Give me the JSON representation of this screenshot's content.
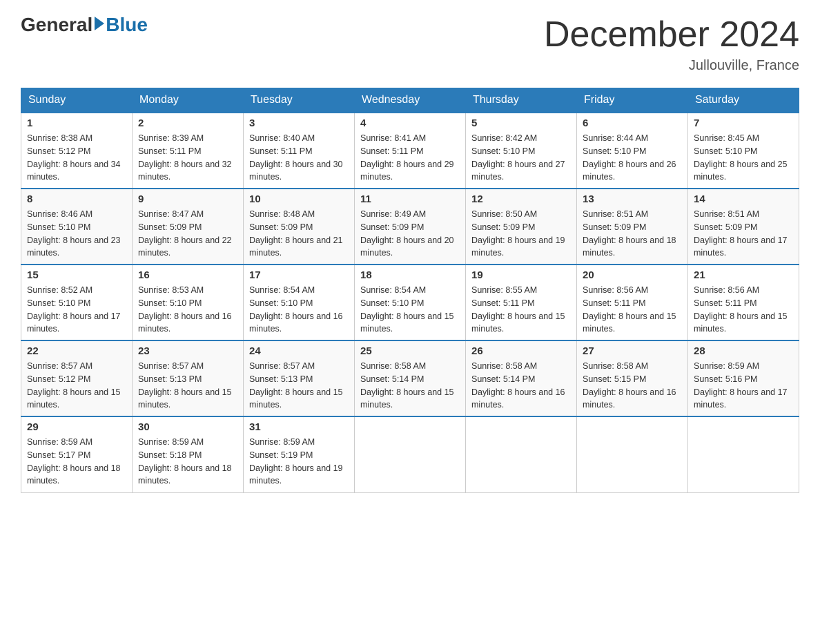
{
  "logo": {
    "general": "General",
    "blue": "Blue"
  },
  "title": "December 2024",
  "subtitle": "Jullouville, France",
  "days_of_week": [
    "Sunday",
    "Monday",
    "Tuesday",
    "Wednesday",
    "Thursday",
    "Friday",
    "Saturday"
  ],
  "weeks": [
    [
      {
        "day": "1",
        "sunrise": "8:38 AM",
        "sunset": "5:12 PM",
        "daylight": "8 hours and 34 minutes."
      },
      {
        "day": "2",
        "sunrise": "8:39 AM",
        "sunset": "5:11 PM",
        "daylight": "8 hours and 32 minutes."
      },
      {
        "day": "3",
        "sunrise": "8:40 AM",
        "sunset": "5:11 PM",
        "daylight": "8 hours and 30 minutes."
      },
      {
        "day": "4",
        "sunrise": "8:41 AM",
        "sunset": "5:11 PM",
        "daylight": "8 hours and 29 minutes."
      },
      {
        "day": "5",
        "sunrise": "8:42 AM",
        "sunset": "5:10 PM",
        "daylight": "8 hours and 27 minutes."
      },
      {
        "day": "6",
        "sunrise": "8:44 AM",
        "sunset": "5:10 PM",
        "daylight": "8 hours and 26 minutes."
      },
      {
        "day": "7",
        "sunrise": "8:45 AM",
        "sunset": "5:10 PM",
        "daylight": "8 hours and 25 minutes."
      }
    ],
    [
      {
        "day": "8",
        "sunrise": "8:46 AM",
        "sunset": "5:10 PM",
        "daylight": "8 hours and 23 minutes."
      },
      {
        "day": "9",
        "sunrise": "8:47 AM",
        "sunset": "5:09 PM",
        "daylight": "8 hours and 22 minutes."
      },
      {
        "day": "10",
        "sunrise": "8:48 AM",
        "sunset": "5:09 PM",
        "daylight": "8 hours and 21 minutes."
      },
      {
        "day": "11",
        "sunrise": "8:49 AM",
        "sunset": "5:09 PM",
        "daylight": "8 hours and 20 minutes."
      },
      {
        "day": "12",
        "sunrise": "8:50 AM",
        "sunset": "5:09 PM",
        "daylight": "8 hours and 19 minutes."
      },
      {
        "day": "13",
        "sunrise": "8:51 AM",
        "sunset": "5:09 PM",
        "daylight": "8 hours and 18 minutes."
      },
      {
        "day": "14",
        "sunrise": "8:51 AM",
        "sunset": "5:09 PM",
        "daylight": "8 hours and 17 minutes."
      }
    ],
    [
      {
        "day": "15",
        "sunrise": "8:52 AM",
        "sunset": "5:10 PM",
        "daylight": "8 hours and 17 minutes."
      },
      {
        "day": "16",
        "sunrise": "8:53 AM",
        "sunset": "5:10 PM",
        "daylight": "8 hours and 16 minutes."
      },
      {
        "day": "17",
        "sunrise": "8:54 AM",
        "sunset": "5:10 PM",
        "daylight": "8 hours and 16 minutes."
      },
      {
        "day": "18",
        "sunrise": "8:54 AM",
        "sunset": "5:10 PM",
        "daylight": "8 hours and 15 minutes."
      },
      {
        "day": "19",
        "sunrise": "8:55 AM",
        "sunset": "5:11 PM",
        "daylight": "8 hours and 15 minutes."
      },
      {
        "day": "20",
        "sunrise": "8:56 AM",
        "sunset": "5:11 PM",
        "daylight": "8 hours and 15 minutes."
      },
      {
        "day": "21",
        "sunrise": "8:56 AM",
        "sunset": "5:11 PM",
        "daylight": "8 hours and 15 minutes."
      }
    ],
    [
      {
        "day": "22",
        "sunrise": "8:57 AM",
        "sunset": "5:12 PM",
        "daylight": "8 hours and 15 minutes."
      },
      {
        "day": "23",
        "sunrise": "8:57 AM",
        "sunset": "5:13 PM",
        "daylight": "8 hours and 15 minutes."
      },
      {
        "day": "24",
        "sunrise": "8:57 AM",
        "sunset": "5:13 PM",
        "daylight": "8 hours and 15 minutes."
      },
      {
        "day": "25",
        "sunrise": "8:58 AM",
        "sunset": "5:14 PM",
        "daylight": "8 hours and 15 minutes."
      },
      {
        "day": "26",
        "sunrise": "8:58 AM",
        "sunset": "5:14 PM",
        "daylight": "8 hours and 16 minutes."
      },
      {
        "day": "27",
        "sunrise": "8:58 AM",
        "sunset": "5:15 PM",
        "daylight": "8 hours and 16 minutes."
      },
      {
        "day": "28",
        "sunrise": "8:59 AM",
        "sunset": "5:16 PM",
        "daylight": "8 hours and 17 minutes."
      }
    ],
    [
      {
        "day": "29",
        "sunrise": "8:59 AM",
        "sunset": "5:17 PM",
        "daylight": "8 hours and 18 minutes."
      },
      {
        "day": "30",
        "sunrise": "8:59 AM",
        "sunset": "5:18 PM",
        "daylight": "8 hours and 18 minutes."
      },
      {
        "day": "31",
        "sunrise": "8:59 AM",
        "sunset": "5:19 PM",
        "daylight": "8 hours and 19 minutes."
      },
      null,
      null,
      null,
      null
    ]
  ]
}
